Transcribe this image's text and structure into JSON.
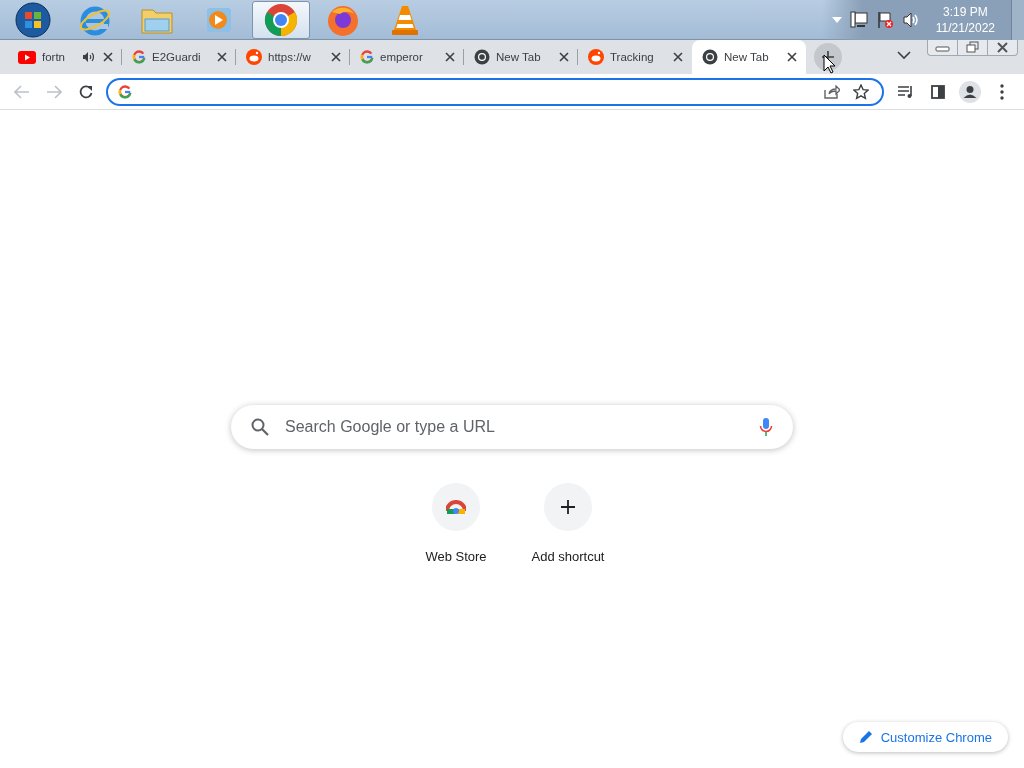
{
  "taskbar": {
    "apps": [
      {
        "kind": "start",
        "selected": false
      },
      {
        "kind": "ie",
        "selected": false
      },
      {
        "kind": "explorer",
        "selected": false
      },
      {
        "kind": "media",
        "selected": false
      },
      {
        "kind": "chrome",
        "selected": true
      },
      {
        "kind": "firefox",
        "selected": false
      },
      {
        "kind": "vlc",
        "selected": false
      }
    ],
    "clock": {
      "time": "3:19 PM",
      "date": "11/21/2022"
    }
  },
  "tabs": [
    {
      "title": "fortn",
      "kind": "youtube",
      "audible": true,
      "selected": false
    },
    {
      "title": "E2Guardi",
      "kind": "google",
      "audible": false,
      "selected": false
    },
    {
      "title": "https://w",
      "kind": "reddit",
      "audible": false,
      "selected": false
    },
    {
      "title": "emperor",
      "kind": "google",
      "audible": false,
      "selected": false
    },
    {
      "title": "New Tab",
      "kind": "chrome",
      "audible": false,
      "selected": false
    },
    {
      "title": "Tracking",
      "kind": "reddit",
      "audible": false,
      "selected": false
    },
    {
      "title": "New Tab",
      "kind": "chrome",
      "audible": false,
      "selected": true
    }
  ],
  "omnibox": {
    "focused": true
  },
  "new_tab_page": {
    "search": {
      "placeholder": "Search Google or type a URL"
    },
    "shortcuts": [
      {
        "label": "Web Store",
        "kind": "webstore"
      },
      {
        "label": "Add shortcut",
        "kind": "add"
      }
    ],
    "customize_button": "Customize Chrome"
  }
}
